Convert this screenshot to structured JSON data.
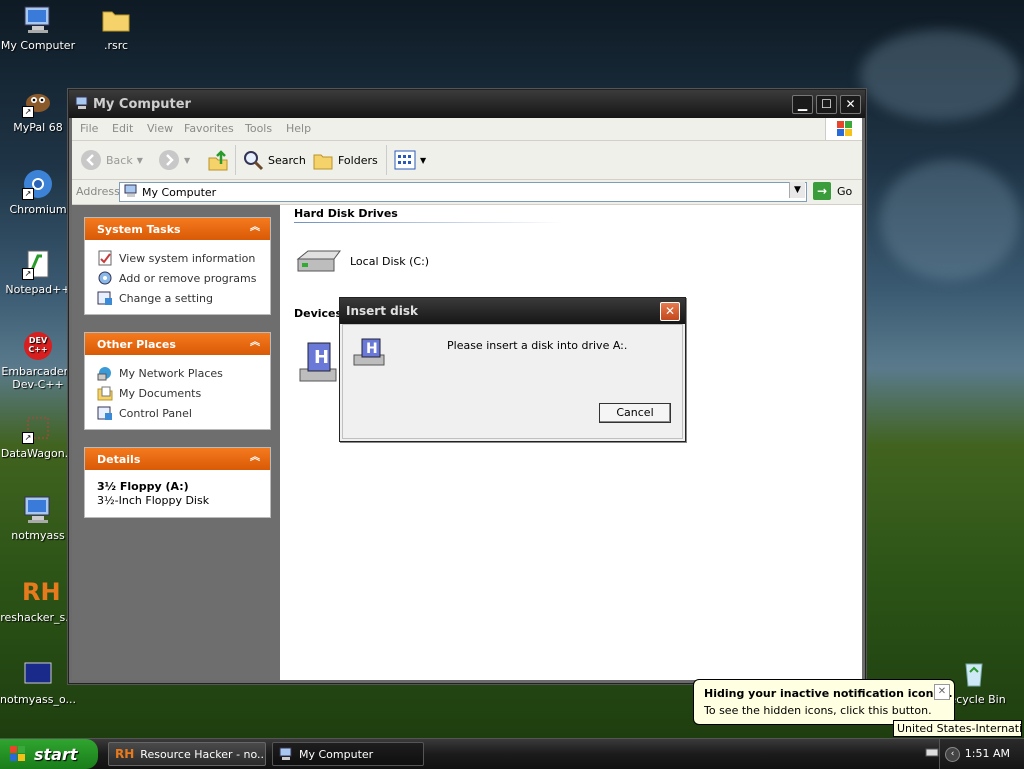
{
  "desktop": {
    "icons": [
      {
        "label": "My Computer",
        "icon": "computer-icon"
      },
      {
        "label": ".rsrc",
        "icon": "folder-icon"
      },
      {
        "label": "MyPal 68",
        "icon": "mypal-icon"
      },
      {
        "label": "Chromium",
        "icon": "chromium-icon"
      },
      {
        "label": "Notepad++",
        "icon": "notepadpp-icon"
      },
      {
        "label": "Embarcadero Dev-C++",
        "icon": "devcpp-icon",
        "badge": "DEV C++"
      },
      {
        "label": "DataWagon...",
        "icon": "datawagon-icon"
      },
      {
        "label": "notmyass",
        "icon": "computer-icon"
      },
      {
        "label": "reshacker_s...",
        "icon": "reshacker-icon",
        "badge": "RH"
      },
      {
        "label": "notmyass_o...",
        "icon": "window-icon"
      },
      {
        "label": "Recycle Bin",
        "icon": "recycle-bin-icon"
      }
    ]
  },
  "window": {
    "title": "My Computer",
    "menu": [
      "File",
      "Edit",
      "View",
      "Favorites",
      "Tools",
      "Help"
    ],
    "toolbar": {
      "back": "Back",
      "search": "Search",
      "folders": "Folders"
    },
    "address": {
      "label": "Address",
      "value": "My Computer",
      "go": "Go"
    },
    "panels": {
      "system_tasks": {
        "title": "System Tasks",
        "items": [
          "View system information",
          "Add or remove programs",
          "Change a setting"
        ]
      },
      "other_places": {
        "title": "Other Places",
        "items": [
          "My Network Places",
          "My Documents",
          "Control Panel"
        ]
      },
      "details": {
        "title": "Details",
        "name": "3½ Floppy (A:)",
        "type": "3½-Inch Floppy Disk"
      }
    },
    "groups": {
      "hard_disks": {
        "title": "Hard Disk Drives",
        "items": [
          "Local Disk (C:)"
        ]
      },
      "devices": {
        "title": "Devices"
      }
    }
  },
  "dialog": {
    "title": "Insert disk",
    "close": "✕",
    "message": "Please insert a disk into drive A:.",
    "cancel": "Cancel"
  },
  "taskbar": {
    "start": "start",
    "apps": [
      {
        "label": "Resource Hacker - no...",
        "icon": "reshacker-icon",
        "badge": "RH"
      },
      {
        "label": "My Computer",
        "icon": "computer-icon"
      }
    ],
    "clock": "1:51 AM"
  },
  "balloon": {
    "title": "Hiding your inactive notification icons...",
    "text": "To see the hidden icons, click this button.",
    "close": "✕"
  },
  "tooltip": "United States-International",
  "colors": {
    "task_header": "#e8680f",
    "start_green": "#2fa52f",
    "titlebar": "#1e1e1e"
  }
}
